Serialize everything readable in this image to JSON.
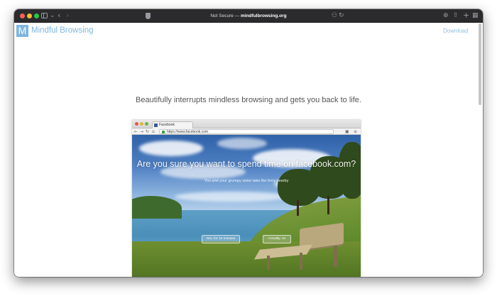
{
  "browser": {
    "address_prefix": "Not Secure — ",
    "address_domain": "mindfulbrowsing.org"
  },
  "header": {
    "logo_letter": "M",
    "logo_text": "Mindful Browsing",
    "download_label": "Download"
  },
  "main": {
    "tagline": "Beautifully interrupts mindless browsing and gets you back to life."
  },
  "preview": {
    "tab_title": "Facebook",
    "url": "https://www.facebook.com",
    "question": "Are you sure you want to spend time on facebook.com?",
    "subtitle": "You and your grumpy sister take the ferry nearby",
    "button_yes": "Yes, for 10 minutes",
    "button_no": "Actually, no"
  },
  "colors": {
    "brand": "#7fb6de",
    "link": "#8fbfe3"
  }
}
